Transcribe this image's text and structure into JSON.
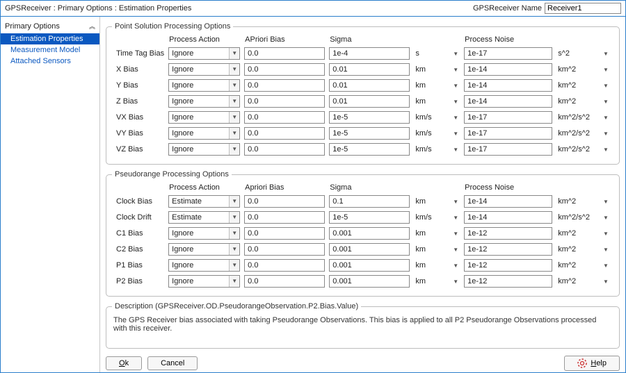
{
  "title": "GPSReceiver : Primary Options : Estimation Properties",
  "nameLabel": "GPSReceiver Name",
  "nameValue": "Receiver1",
  "sidebar": {
    "header": "Primary Options",
    "items": [
      {
        "label": "Estimation Properties",
        "selected": true
      },
      {
        "label": "Measurement Model",
        "selected": false
      },
      {
        "label": "Attached Sensors",
        "selected": false
      }
    ]
  },
  "group1": {
    "legend": "Point Solution Processing Options",
    "headers": [
      "Process Action",
      "APriori Bias",
      "Sigma",
      "",
      "Process Noise",
      ""
    ],
    "rows": [
      {
        "label": "Time Tag Bias",
        "action": "Ignore",
        "apriori": "0.0",
        "sigma": "1e-4",
        "unitA": "s",
        "noise": "1e-17",
        "unitB": "s^2"
      },
      {
        "label": "X Bias",
        "action": "Ignore",
        "apriori": "0.0",
        "sigma": "0.01",
        "unitA": "km",
        "noise": "1e-14",
        "unitB": "km^2"
      },
      {
        "label": "Y Bias",
        "action": "Ignore",
        "apriori": "0.0",
        "sigma": "0.01",
        "unitA": "km",
        "noise": "1e-14",
        "unitB": "km^2"
      },
      {
        "label": "Z Bias",
        "action": "Ignore",
        "apriori": "0.0",
        "sigma": "0.01",
        "unitA": "km",
        "noise": "1e-14",
        "unitB": "km^2"
      },
      {
        "label": "VX Bias",
        "action": "Ignore",
        "apriori": "0.0",
        "sigma": "1e-5",
        "unitA": "km/s",
        "noise": "1e-17",
        "unitB": "km^2/s^2"
      },
      {
        "label": "VY Bias",
        "action": "Ignore",
        "apriori": "0.0",
        "sigma": "1e-5",
        "unitA": "km/s",
        "noise": "1e-17",
        "unitB": "km^2/s^2"
      },
      {
        "label": "VZ Bias",
        "action": "Ignore",
        "apriori": "0.0",
        "sigma": "1e-5",
        "unitA": "km/s",
        "noise": "1e-17",
        "unitB": "km^2/s^2"
      }
    ]
  },
  "group2": {
    "legend": "Pseudorange Processing Options",
    "headers": [
      "Process Action",
      "Apriori Bias",
      "Sigma",
      "",
      "Process Noise",
      ""
    ],
    "rows": [
      {
        "label": "Clock Bias",
        "action": "Estimate",
        "apriori": "0.0",
        "sigma": "0.1",
        "unitA": "km",
        "noise": "1e-14",
        "unitB": "km^2"
      },
      {
        "label": "Clock Drift",
        "action": "Estimate",
        "apriori": "0.0",
        "sigma": "1e-5",
        "unitA": "km/s",
        "noise": "1e-14",
        "unitB": "km^2/s^2"
      },
      {
        "label": "C1 Bias",
        "action": "Ignore",
        "apriori": "0.0",
        "sigma": "0.001",
        "unitA": "km",
        "noise": "1e-12",
        "unitB": "km^2"
      },
      {
        "label": "C2 Bias",
        "action": "Ignore",
        "apriori": "0.0",
        "sigma": "0.001",
        "unitA": "km",
        "noise": "1e-12",
        "unitB": "km^2"
      },
      {
        "label": "P1 Bias",
        "action": "Ignore",
        "apriori": "0.0",
        "sigma": "0.001",
        "unitA": "km",
        "noise": "1e-12",
        "unitB": "km^2"
      },
      {
        "label": "P2 Bias",
        "action": "Ignore",
        "apriori": "0.0",
        "sigma": "0.001",
        "unitA": "km",
        "noise": "1e-12",
        "unitB": "km^2"
      }
    ]
  },
  "description": {
    "legend": "Description (GPSReceiver.OD.PseudorangeObservation.P2.Bias.Value)",
    "text": "The GPS Receiver bias associated with taking Pseudorange Observations. This bias is applied to all P2 Pseudorange Observations processed with this receiver."
  },
  "buttons": {
    "ok": "Ok",
    "cancel": "Cancel",
    "help": "Help"
  }
}
